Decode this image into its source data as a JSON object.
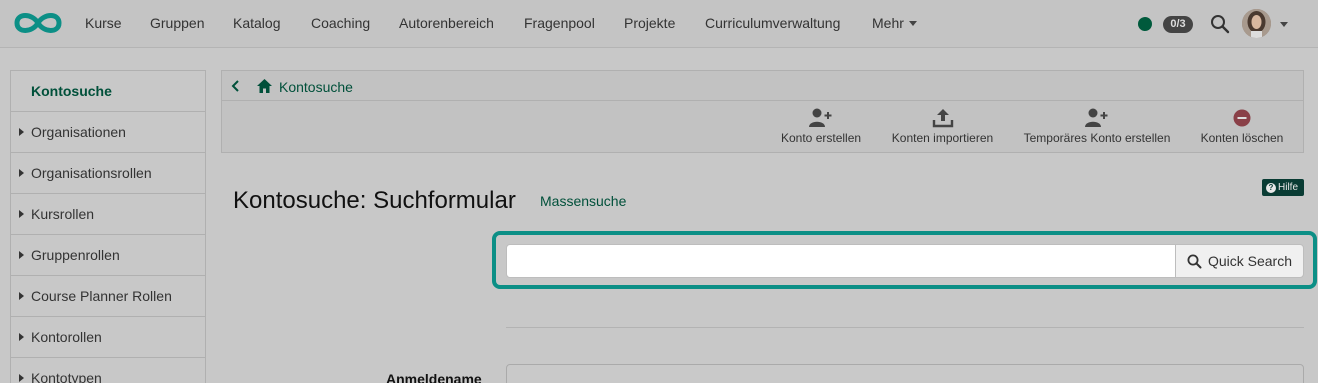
{
  "colors": {
    "accent": "#00503a",
    "highlight": "#0c8f86",
    "status_online": "#005a3c"
  },
  "nav": {
    "items": [
      "Kurse",
      "Gruppen",
      "Katalog",
      "Coaching",
      "Autorenbereich",
      "Fragenpool",
      "Projekte",
      "Curriculumverwaltung"
    ],
    "more_label": "Mehr",
    "badge": "0/3",
    "icons": [
      "openolat-logo-icon",
      "online-status-icon",
      "search-icon",
      "avatar",
      "chevron-down-icon"
    ]
  },
  "sidebar": {
    "items": [
      {
        "label": "Kontosuche",
        "active": true
      },
      {
        "label": "Organisationen"
      },
      {
        "label": "Organisationsrollen"
      },
      {
        "label": "Kursrollen"
      },
      {
        "label": "Gruppenrollen"
      },
      {
        "label": "Course Planner Rollen"
      },
      {
        "label": "Kontorollen"
      },
      {
        "label": "Kontotypen"
      }
    ]
  },
  "breadcrumb": {
    "label": "Kontosuche",
    "icons": [
      "back-arrow-icon",
      "home-icon"
    ]
  },
  "toolbar": {
    "create": {
      "label": "Konto erstellen",
      "icon": "user-plus-icon"
    },
    "import": {
      "label": "Konten importieren",
      "icon": "upload-icon"
    },
    "temp": {
      "label": "Temporäres Konto erstellen",
      "icon": "user-plus-icon"
    },
    "delete": {
      "label": "Konten löschen",
      "icon": "minus-circle-icon"
    }
  },
  "main": {
    "title": "Kontosuche: Suchformular",
    "mass_search": "Massensuche",
    "help": "Hilfe",
    "quick_search": {
      "value": "",
      "placeholder": "",
      "button": "Quick Search"
    },
    "form": {
      "login_label": "Anmeldename"
    }
  }
}
